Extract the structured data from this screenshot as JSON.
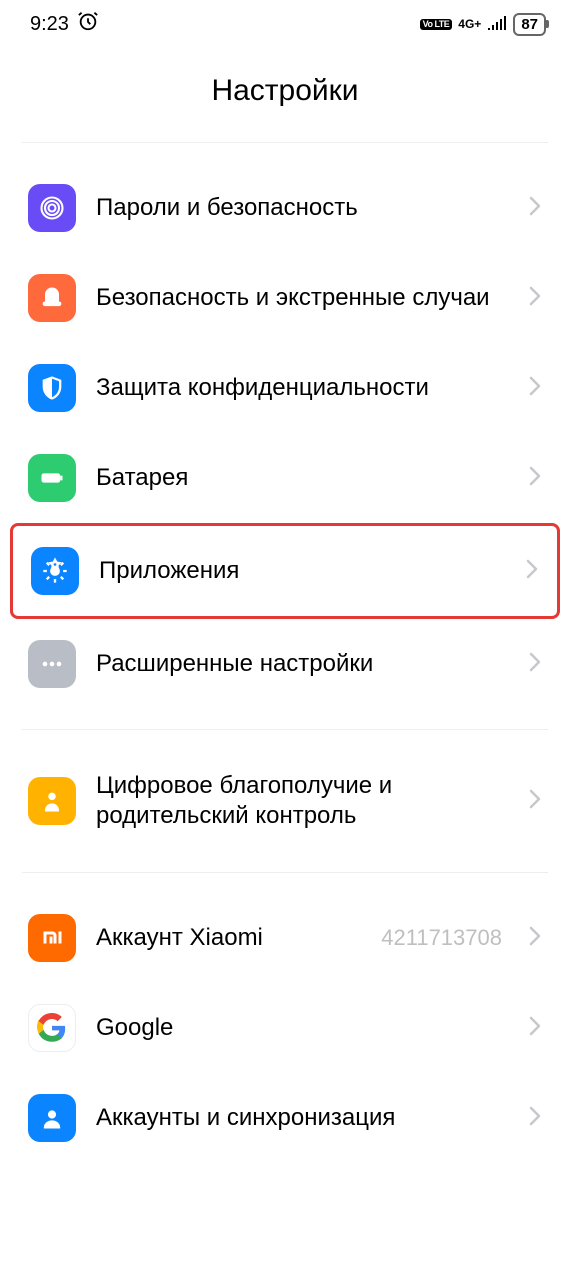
{
  "status": {
    "time": "9:23",
    "network_label": "4G+",
    "volte": "Vo LTE",
    "battery": "87"
  },
  "page_title": "Настройки",
  "groups": [
    {
      "items": [
        {
          "key": "security",
          "label": "Пароли и безопасность",
          "iconBg": "#6a4cf7",
          "dataname": "sidebar-item-passwords-security",
          "icon": "fingerprint"
        },
        {
          "key": "emergency",
          "label": "Безопасность и экстренные случаи",
          "iconBg": "#ff6a3d",
          "dataname": "sidebar-item-emergency",
          "icon": "emergency"
        },
        {
          "key": "privacy",
          "label": "Защита конфиденциально­сти",
          "iconBg": "#0a84ff",
          "dataname": "sidebar-item-privacy",
          "icon": "privacy"
        },
        {
          "key": "battery",
          "label": "Батарея",
          "iconBg": "#2ecc71",
          "dataname": "sidebar-item-battery",
          "icon": "battery"
        },
        {
          "key": "apps",
          "label": "Приложения",
          "iconBg": "#0a84ff",
          "highlighted": true,
          "dataname": "sidebar-item-apps",
          "icon": "apps"
        },
        {
          "key": "advanced",
          "label": "Расширенные настройки",
          "iconBg": "#b9bec6",
          "dataname": "sidebar-item-advanced",
          "icon": "more"
        }
      ]
    },
    {
      "items": [
        {
          "key": "wellbeing",
          "label": "Цифровое благополучие и родительский контроль",
          "iconBg": "#ffb300",
          "dataname": "sidebar-item-wellbeing",
          "icon": "wellbeing"
        }
      ]
    },
    {
      "items": [
        {
          "key": "miaccount",
          "label": "Аккаунт Xiaomi",
          "value": "4211713708",
          "iconBg": "#ff6a00",
          "dataname": "sidebar-item-mi-account",
          "icon": "mi"
        },
        {
          "key": "google",
          "label": "Google",
          "iconBg": "#ffffff",
          "dataname": "sidebar-item-google",
          "icon": "google",
          "iconBorder": true
        },
        {
          "key": "accounts",
          "label": "Аккаунты и синхронизация",
          "iconBg": "#0a84ff",
          "dataname": "sidebar-item-accounts-sync",
          "icon": "accounts"
        }
      ]
    }
  ]
}
